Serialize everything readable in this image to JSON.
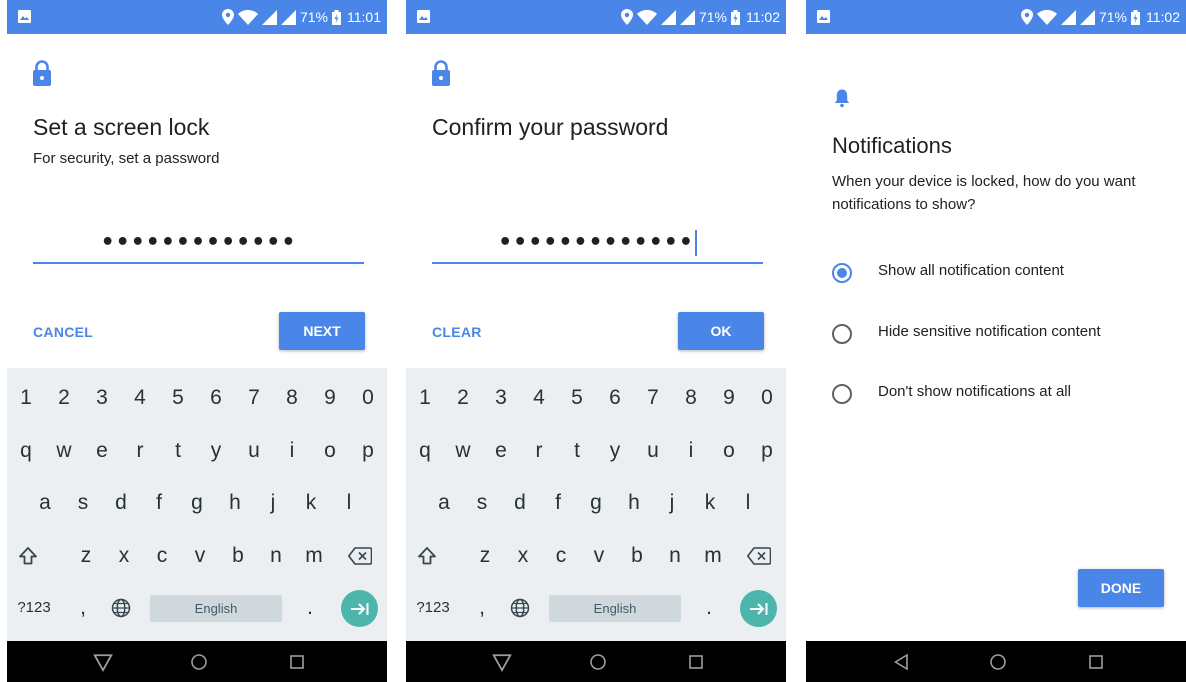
{
  "colors": {
    "accent": "#4a86e8",
    "enter_key": "#4db6ac",
    "keyboard_bg": "#eceff1",
    "nav_bg": "#000000"
  },
  "screens": [
    {
      "status": {
        "battery": "71%",
        "time": "11:01"
      },
      "title": "Set a screen lock",
      "subtitle": "For security, set a password",
      "password_value": "•••••••••••••",
      "left_action": "CANCEL",
      "right_action": "NEXT"
    },
    {
      "status": {
        "battery": "71%",
        "time": "11:02"
      },
      "title": "Confirm your password",
      "password_value": "•••••••••••••",
      "left_action": "CLEAR",
      "right_action": "OK"
    },
    {
      "status": {
        "battery": "71%",
        "time": "11:02"
      },
      "title": "Notifications",
      "subtitle": "When your device is locked, how do you want notifications to show?",
      "options": [
        {
          "label": "Show all notification content",
          "selected": true
        },
        {
          "label": "Hide sensitive notification content",
          "selected": false
        },
        {
          "label": "Don't show notifications at all",
          "selected": false
        }
      ],
      "done": "DONE"
    }
  ],
  "keyboard": {
    "numbers": [
      "1",
      "2",
      "3",
      "4",
      "5",
      "6",
      "7",
      "8",
      "9",
      "0"
    ],
    "row1": [
      "q",
      "w",
      "e",
      "r",
      "t",
      "y",
      "u",
      "i",
      "o",
      "p"
    ],
    "row2": [
      "a",
      "s",
      "d",
      "f",
      "g",
      "h",
      "j",
      "k",
      "l"
    ],
    "row3": [
      "z",
      "x",
      "c",
      "v",
      "b",
      "n",
      "m"
    ],
    "symbols_key": "?123",
    "comma": ",",
    "period": ".",
    "space_label": "English"
  },
  "icons": {
    "status_left": "image-icon",
    "status_right": [
      "location-icon",
      "wifi-icon",
      "signal-icon",
      "signal-icon",
      "battery-icon"
    ],
    "header_screen1": "lock-icon",
    "header_screen2": "lock-icon",
    "header_screen3": "bell-icon",
    "keyboard": [
      "shift-icon",
      "backspace-icon",
      "globe-icon",
      "enter-icon"
    ],
    "nav": [
      "back-icon",
      "home-icon",
      "recents-icon"
    ]
  }
}
